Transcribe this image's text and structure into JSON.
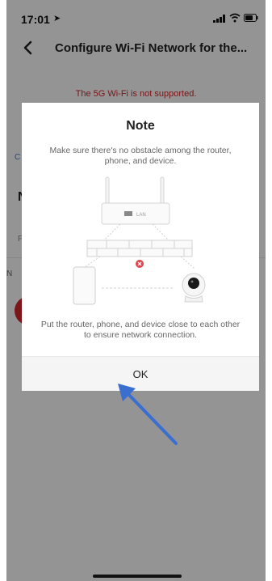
{
  "status_bar": {
    "time": "17:01",
    "location_icon": "location-arrow-icon",
    "signal_icon": "cellular-signal-icon",
    "wifi_icon": "wifi-icon",
    "battery_icon": "battery-icon"
  },
  "header": {
    "title": "Configure Wi-Fi Network for the...",
    "back_icon": "chevron-left-icon"
  },
  "warning": "The 5G Wi-Fi is not supported.",
  "background": {
    "link_fragment": "C",
    "label_n": "N",
    "label_f": "F",
    "label_n2": "N"
  },
  "modal": {
    "title": "Note",
    "description": "Make sure there's no obstacle among the router, phone, and device.",
    "router_label": "LAN",
    "tip": "Put the router, phone, and device close to each other to ensure network connection.",
    "ok_label": "OK"
  },
  "colors": {
    "accent_red": "#d8262b",
    "arrow_blue": "#3a6fd0"
  }
}
